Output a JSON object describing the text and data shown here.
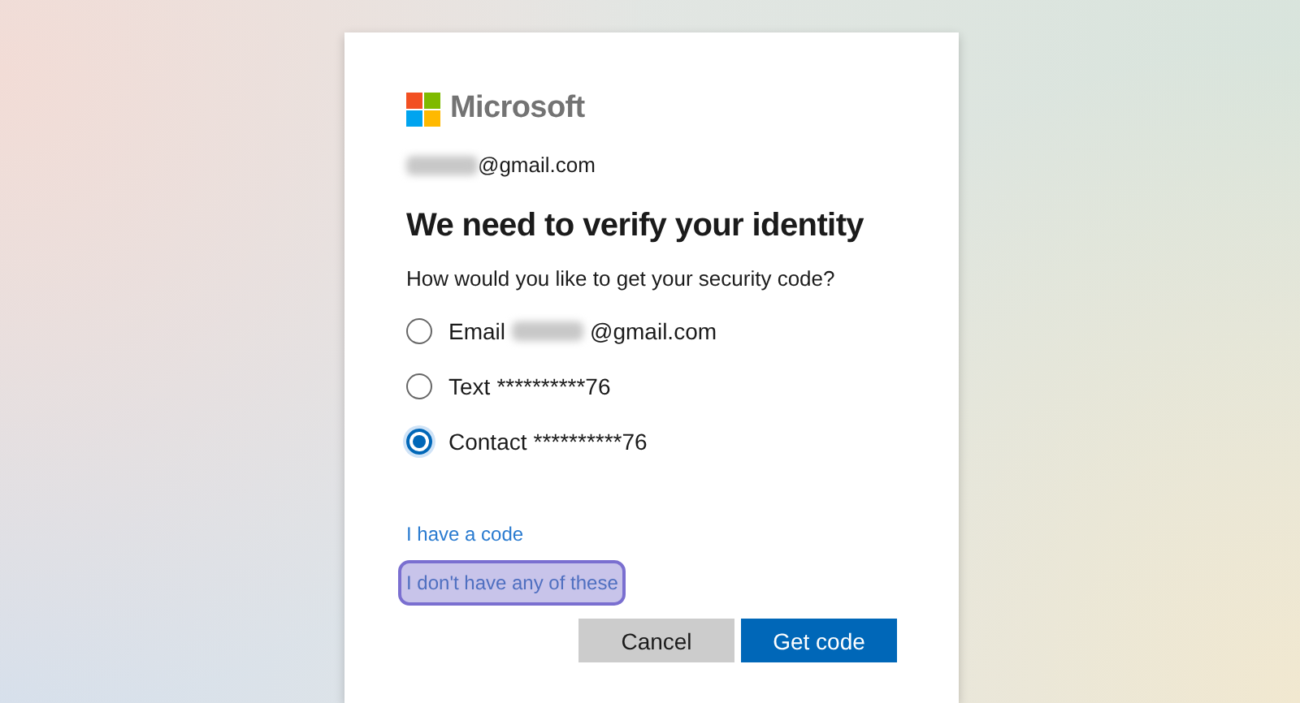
{
  "brand": {
    "name": "Microsoft"
  },
  "account": {
    "redacted": true,
    "text": "@gmail.com"
  },
  "title": "We need to verify your identity",
  "prompt": "How would you like to get your security code?",
  "options": [
    {
      "label": "Email",
      "redacted": true,
      "value": "@gmail.com",
      "selected": false
    },
    {
      "label": "Text",
      "redacted": false,
      "value": "**********76",
      "selected": false
    },
    {
      "label": "Contact",
      "redacted": false,
      "value": "**********76",
      "selected": true
    }
  ],
  "links": [
    {
      "text": "I have a code",
      "focused": false
    },
    {
      "text": "I don't have any of these",
      "focused": true
    }
  ],
  "buttons": [
    {
      "text": "Cancel",
      "kind": "secondary"
    },
    {
      "text": "Get code",
      "kind": "primary"
    }
  ]
}
